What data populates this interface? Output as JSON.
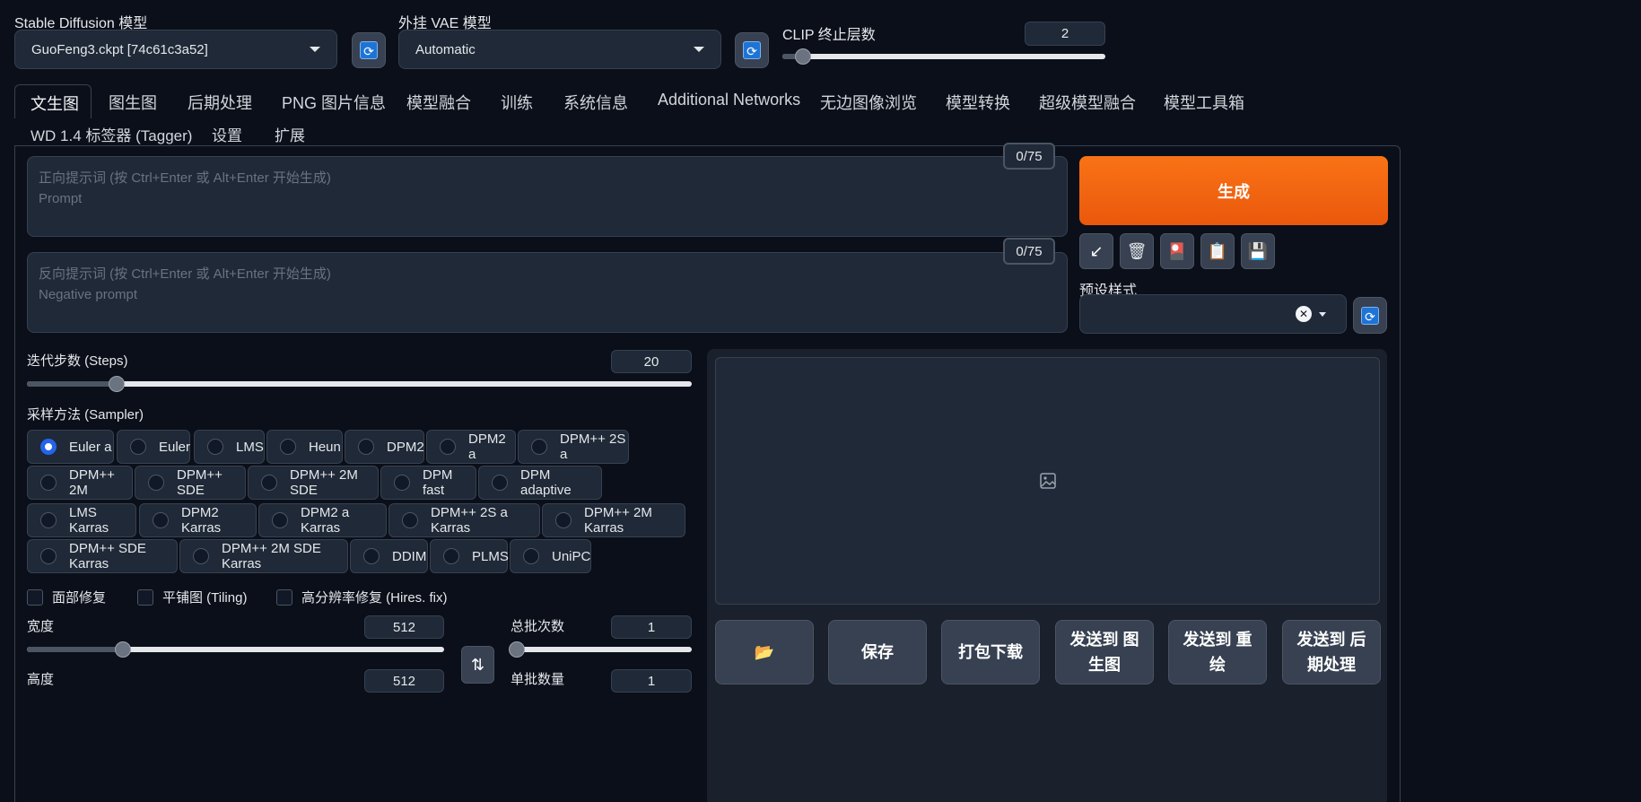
{
  "top": {
    "sd_model_label": "Stable Diffusion 模型",
    "sd_model_value": "GuoFeng3.ckpt [74c61c3a52]",
    "vae_label": "外挂 VAE 模型",
    "vae_value": "Automatic",
    "clip_label": "CLIP 终止层数",
    "clip_value": "2",
    "clip_fraction": 0.08
  },
  "tabs": [
    "文生图",
    "图生图",
    "后期处理",
    "PNG 图片信息",
    "模型融合",
    "训练",
    "系统信息",
    "Additional Networks",
    "无边图像浏览",
    "模型转换",
    "超级模型融合",
    "模型工具箱"
  ],
  "tabs_row2": [
    "WD 1.4 标签器 (Tagger)",
    "设置",
    "扩展"
  ],
  "prompt": {
    "positive_placeholder_line1": "正向提示词 (按 Ctrl+Enter 或 Alt+Enter 开始生成)",
    "positive_placeholder_line2": "Prompt",
    "positive_counter": "0/75",
    "negative_placeholder_line1": "反向提示词 (按 Ctrl+Enter 或 Alt+Enter 开始生成)",
    "negative_placeholder_line2": "Negative prompt",
    "negative_counter": "0/75"
  },
  "actions": {
    "generate_label": "生成",
    "tools": [
      "↙",
      "🗑",
      "🎴",
      "📋",
      "💾"
    ],
    "styles_label": "预设样式"
  },
  "steps": {
    "label": "迭代步数 (Steps)",
    "value": "20",
    "fraction": 0.13
  },
  "sampler": {
    "label": "采样方法 (Sampler)",
    "rows": [
      [
        "Euler a",
        "Euler",
        "LMS",
        "Heun",
        "DPM2",
        "DPM2 a",
        "DPM++ 2S a"
      ],
      [
        "DPM++ 2M",
        "DPM++ SDE",
        "DPM++ 2M SDE",
        "DPM fast",
        "DPM adaptive"
      ],
      [
        "LMS Karras",
        "DPM2 Karras",
        "DPM2 a Karras",
        "DPM++ 2S a Karras",
        "DPM++ 2M Karras"
      ],
      [
        "DPM++ SDE Karras",
        "DPM++ 2M SDE Karras",
        "DDIM",
        "PLMS",
        "UniPC"
      ]
    ],
    "selected": "Euler a"
  },
  "checks": [
    "面部修复",
    "平铺图 (Tiling)",
    "高分辨率修复 (Hires. fix)"
  ],
  "width": {
    "label": "宽度",
    "value": "512",
    "fraction": 0.23
  },
  "height": {
    "label": "高度",
    "value": "512"
  },
  "swap_icon": "⇅",
  "batch_count": {
    "label": "总批次数",
    "value": "1",
    "fraction": 0.0
  },
  "batch_size": {
    "label": "单批数量",
    "value": "1"
  },
  "output": {
    "buttons": [
      "📂",
      "保存",
      "打包下载",
      "发送到 图生图",
      "发送到 重绘",
      "发送到 后期处理"
    ]
  }
}
